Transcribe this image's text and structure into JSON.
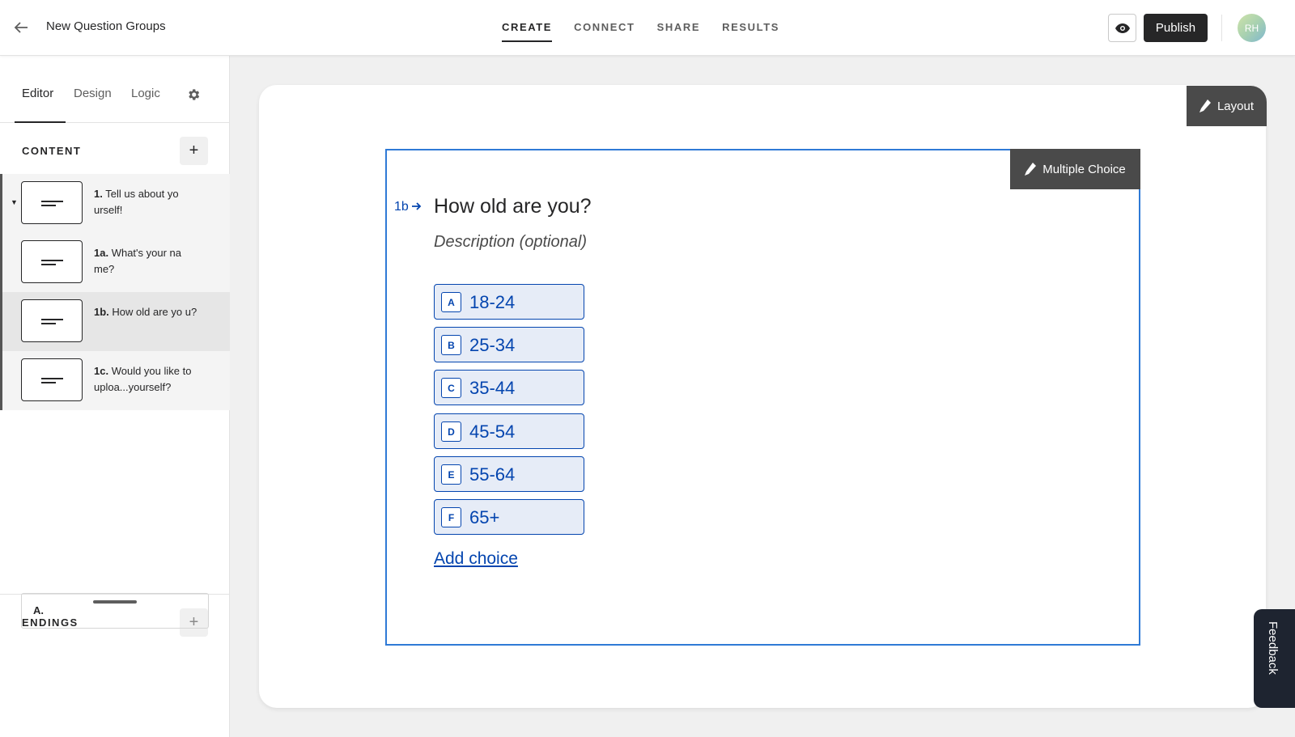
{
  "header": {
    "title": "New Question Groups",
    "nav": [
      "CREATE",
      "CONNECT",
      "SHARE",
      "RESULTS"
    ],
    "active_nav": "CREATE",
    "publish_label": "Publish",
    "avatar_initials": "RH"
  },
  "sidebar": {
    "tabs": [
      "Editor",
      "Design",
      "Logic"
    ],
    "active_tab": "Editor",
    "content_label": "CONTENT",
    "questions": [
      {
        "num": "1.",
        "text": "Tell us about yo urself!"
      },
      {
        "num": "1a.",
        "text": "What's your na me?"
      },
      {
        "num": "1b.",
        "text": "How old are yo u?"
      },
      {
        "num": "1c.",
        "text": "Would you like to uploa...yourself?"
      }
    ],
    "selected_index": 2,
    "endings_label": "ENDINGS",
    "endings": [
      "A."
    ]
  },
  "editor": {
    "layout_label": "Layout",
    "question_type_label": "Multiple Choice",
    "question_number": "1b",
    "question_title": "How old are you?",
    "description_placeholder": "Description (optional)",
    "choices": [
      {
        "key": "A",
        "label": "18-24"
      },
      {
        "key": "B",
        "label": "25-34"
      },
      {
        "key": "C",
        "label": "35-44"
      },
      {
        "key": "D",
        "label": "45-54"
      },
      {
        "key": "E",
        "label": "55-64"
      },
      {
        "key": "F",
        "label": "65+"
      }
    ],
    "add_choice_label": "Add choice"
  },
  "feedback_label": "Feedback",
  "colors": {
    "accent": "#0445af",
    "selection": "#2f7ad6",
    "dark": "#262627"
  }
}
